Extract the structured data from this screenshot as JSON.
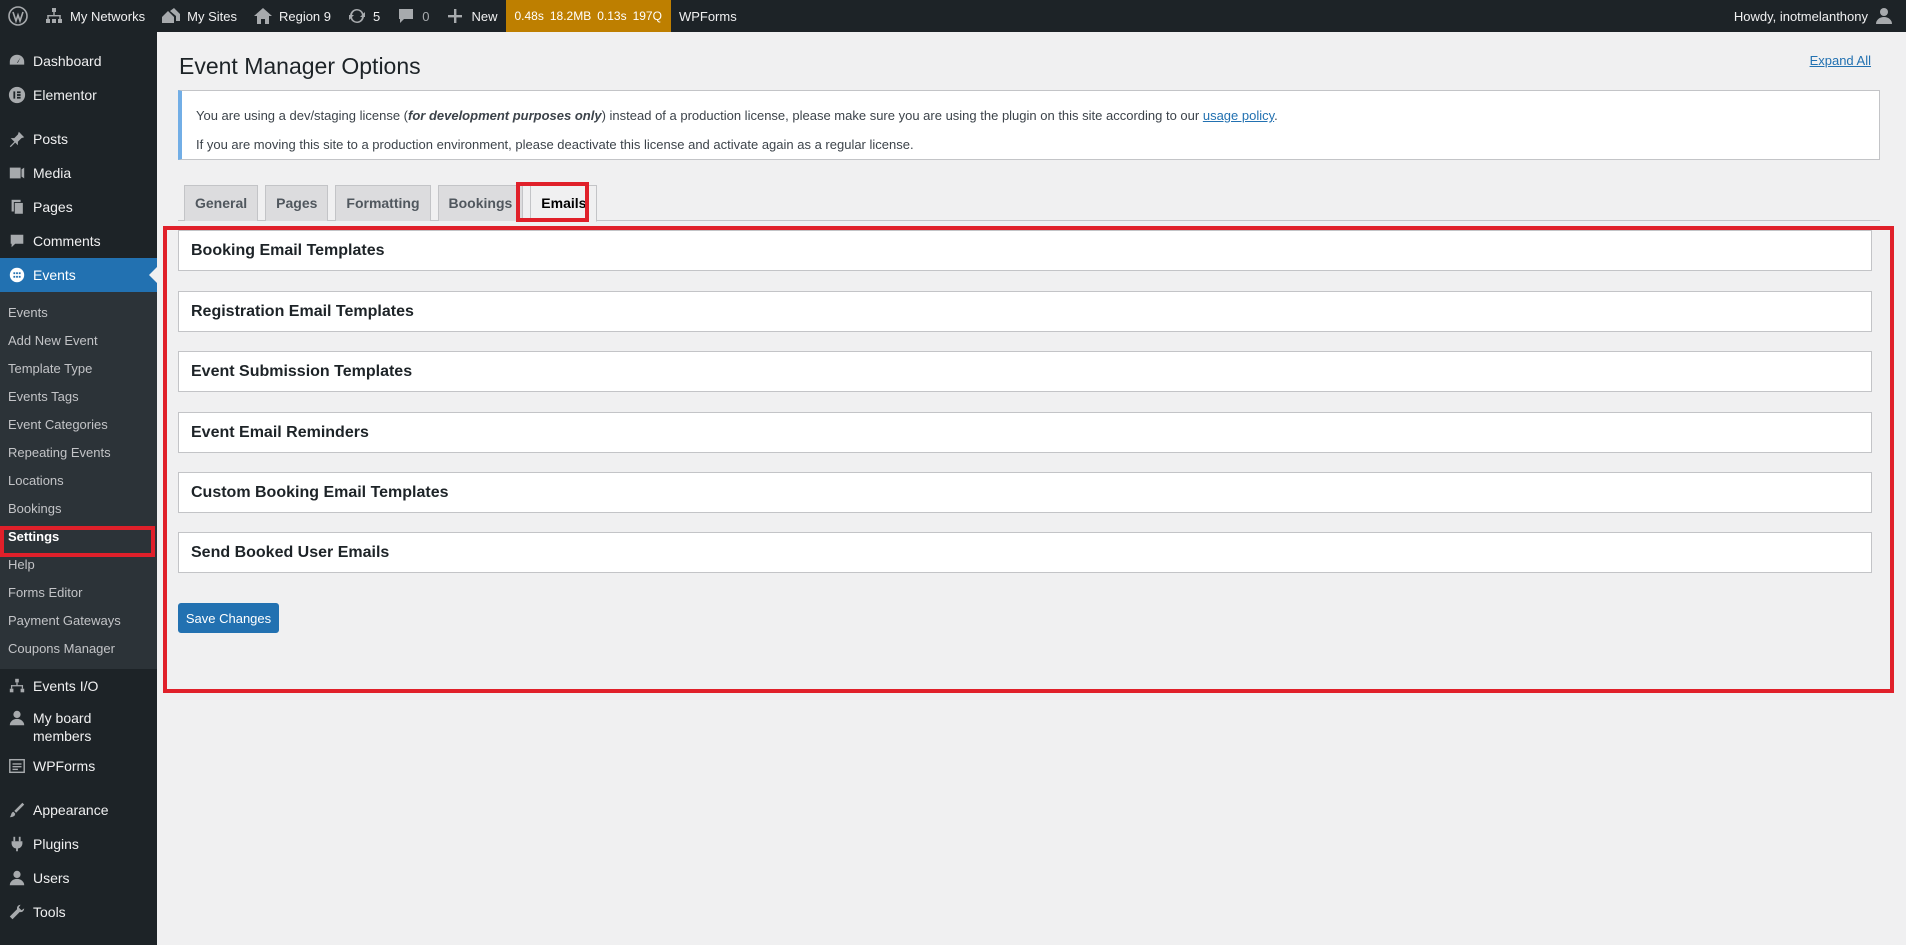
{
  "adminbar": {
    "my_networks": "My Networks",
    "my_sites": "My Sites",
    "site_name": "Region 9",
    "updates_count": "5",
    "comments_count": "0",
    "new_label": "New",
    "qm": {
      "time": "0.48s",
      "memory": "18.2MB",
      "db_time": "0.13s",
      "queries": "197Q"
    },
    "wpforms": "WPForms",
    "howdy": "Howdy, inotmelanthony"
  },
  "sidebar": {
    "dashboard": "Dashboard",
    "elementor": "Elementor",
    "posts": "Posts",
    "media": "Media",
    "pages": "Pages",
    "comments": "Comments",
    "events": "Events",
    "events_submenu": [
      "Events",
      "Add New Event",
      "Template Type",
      "Events Tags",
      "Event Categories",
      "Repeating Events",
      "Locations",
      "Bookings",
      "Settings",
      "Help",
      "Forms Editor",
      "Payment Gateways",
      "Coupons Manager"
    ],
    "events_io": "Events I/O",
    "board_members": "My board members",
    "wpforms": "WPForms",
    "appearance": "Appearance",
    "plugins": "Plugins",
    "users": "Users",
    "tools": "Tools"
  },
  "main": {
    "title": "Event Manager Options",
    "expand_all": "Expand All",
    "notice": {
      "line1_a": "You are using a dev/staging license (",
      "line1_b": "for development purposes only",
      "line1_c": ") instead of a production license, please make sure you are using the plugin on this site according to our ",
      "line1_link": "usage policy",
      "line1_d": ".",
      "line2": "If you are moving this site to a production environment, please deactivate this license and activate again as a regular license."
    },
    "tabs": [
      "General",
      "Pages",
      "Formatting",
      "Bookings",
      "Emails"
    ],
    "active_tab": "Emails",
    "sections": [
      "Booking Email Templates",
      "Registration Email Templates",
      "Event Submission Templates",
      "Event Email Reminders",
      "Custom Booking Email Templates",
      "Send Booked User Emails"
    ],
    "save_button": "Save Changes"
  },
  "colors": {
    "adminbar_bg": "#1d2327",
    "accent": "#2271b1",
    "highlight": "#e0202a",
    "qm_bg": "#be7f00"
  }
}
